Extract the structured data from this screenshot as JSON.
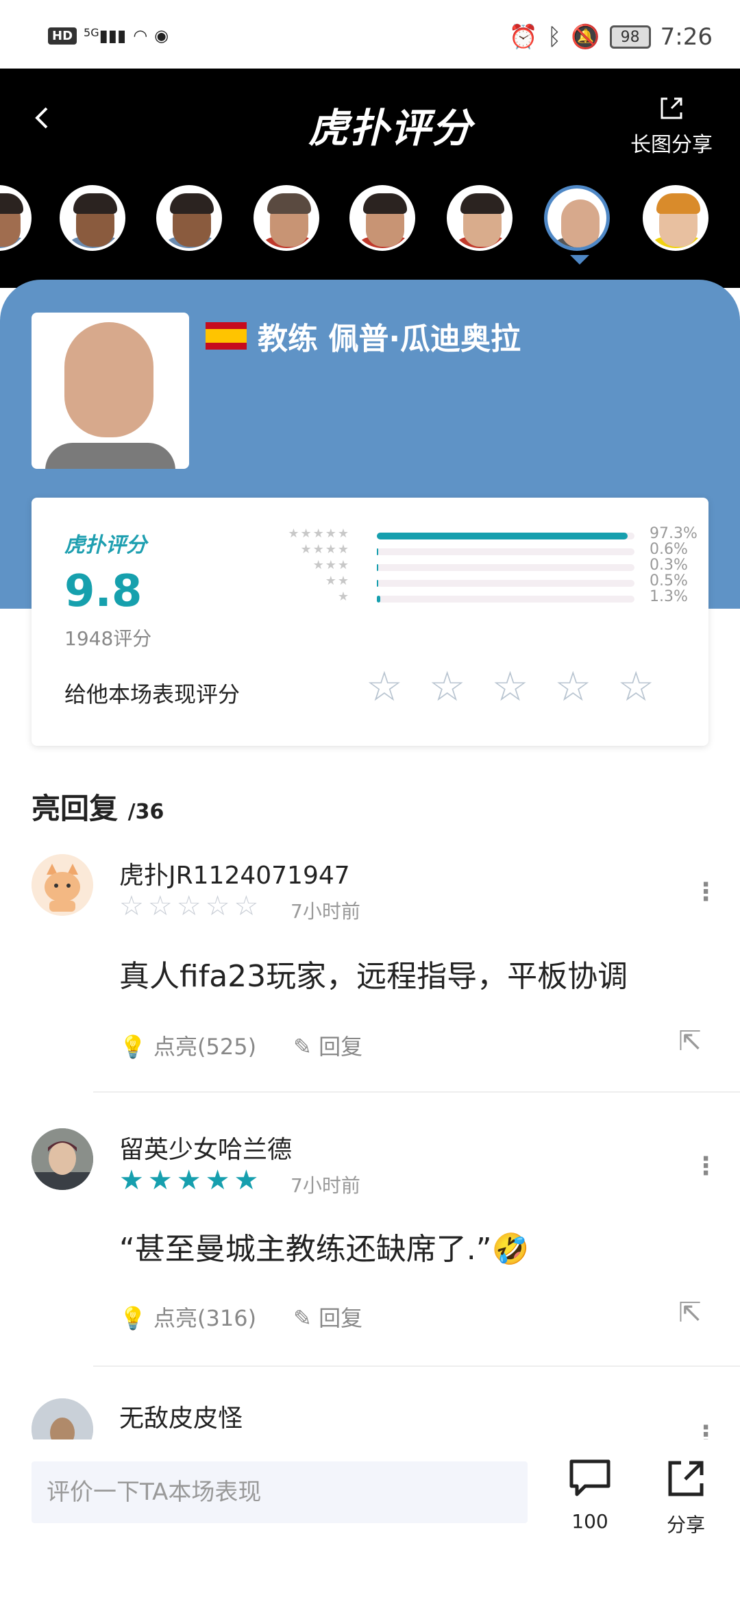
{
  "status_bar": {
    "left_badge": "HD",
    "signal": "5G",
    "battery": "98",
    "time": "7:26"
  },
  "header": {
    "logo": "虎扑评分",
    "share_label": "长图分享"
  },
  "coach": {
    "name": "教练 佩普·瓜迪奥拉",
    "flag": "spain-flag"
  },
  "rating": {
    "logo": "虎扑评分",
    "score": "9.8",
    "count": "1948评分",
    "distribution": [
      {
        "stars": "★★★★★",
        "percent": "97.3%",
        "value": 97.3
      },
      {
        "stars": "★★★★",
        "percent": "0.6%",
        "value": 0.6
      },
      {
        "stars": "★★★",
        "percent": "0.3%",
        "value": 0.3
      },
      {
        "stars": "★★",
        "percent": "0.5%",
        "value": 0.5
      },
      {
        "stars": "★",
        "percent": "1.3%",
        "value": 1.3
      }
    ],
    "rate_label": "给他本场表现评分"
  },
  "section": {
    "title": "亮回复",
    "count": "/36"
  },
  "comments": [
    {
      "user": "虎扑JR1124071947",
      "rating": 0,
      "time": "7小时前",
      "text": "真人fifa23玩家，远程指导，平板协调",
      "like": "点亮(525)",
      "reply": "回复"
    },
    {
      "user": "留英少女哈兰德",
      "rating": 5,
      "time": "7小时前",
      "text": "“甚至曼城主教练还缺席了.”🤣",
      "like": "点亮(316)",
      "reply": "回复"
    },
    {
      "user": "无敌皮皮怪"
    }
  ],
  "bottom": {
    "placeholder": "评价一下TA本场表现",
    "comment_count": "100",
    "share_label": "分享"
  },
  "colors": {
    "accent": "#169fae",
    "panel": "#5f93c6",
    "header_bg": "#000000"
  }
}
